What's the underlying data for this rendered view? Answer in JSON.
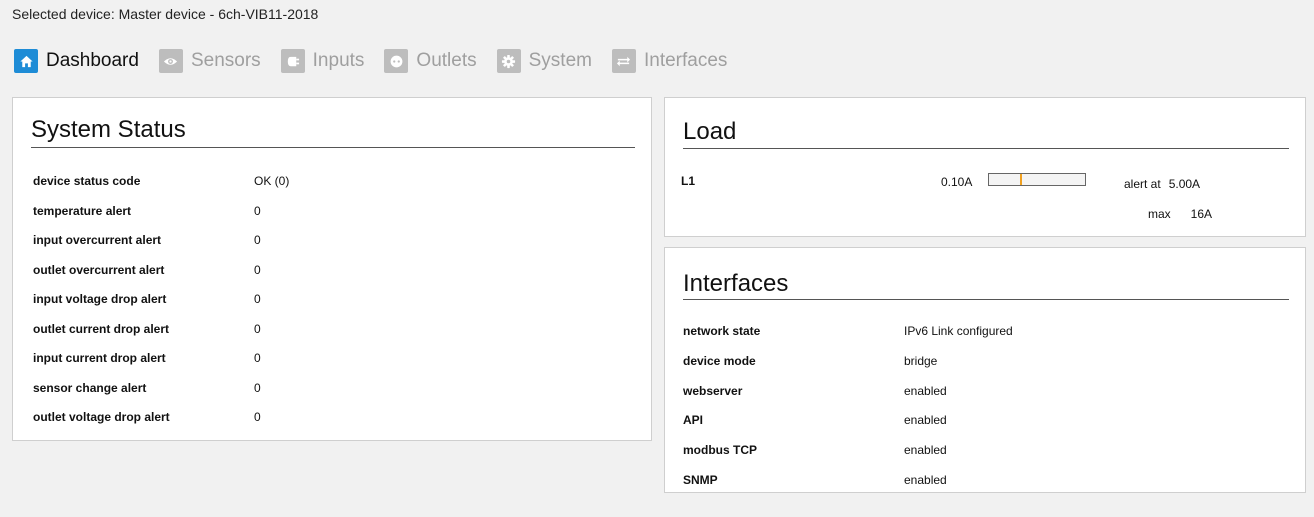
{
  "header": {
    "selected_device": "Selected device: Master device - 6ch-VIB11-2018"
  },
  "nav": {
    "items": [
      {
        "label": "Dashboard",
        "icon": "home-icon",
        "active": true
      },
      {
        "label": "Sensors",
        "icon": "eye-icon",
        "active": false
      },
      {
        "label": "Inputs",
        "icon": "plug-icon",
        "active": false
      },
      {
        "label": "Outlets",
        "icon": "outlet-icon",
        "active": false
      },
      {
        "label": "System",
        "icon": "gear-icon",
        "active": false
      },
      {
        "label": "Interfaces",
        "icon": "arrows-icon",
        "active": false
      }
    ]
  },
  "system_status": {
    "title": "System Status",
    "rows": [
      {
        "label": "device status code",
        "value": "OK (0)"
      },
      {
        "label": "temperature alert",
        "value": "0"
      },
      {
        "label": "input overcurrent alert",
        "value": "0"
      },
      {
        "label": "outlet overcurrent alert",
        "value": "0"
      },
      {
        "label": "input voltage drop alert",
        "value": "0"
      },
      {
        "label": "outlet current drop alert",
        "value": "0"
      },
      {
        "label": "input current drop alert",
        "value": "0"
      },
      {
        "label": "sensor change alert",
        "value": "0"
      },
      {
        "label": "outlet voltage drop alert",
        "value": "0"
      }
    ]
  },
  "load": {
    "title": "Load",
    "line": "L1",
    "current": "0.10A",
    "alert_label": "alert at",
    "alert_value": "5.00A",
    "max_label": "max",
    "max_value": "16A",
    "bar_fill_fraction": 0.32,
    "marker_color": "#f0a020"
  },
  "interfaces": {
    "title": "Interfaces",
    "rows": [
      {
        "label": "network state",
        "value": "IPv6 Link configured"
      },
      {
        "label": "device mode",
        "value": "bridge"
      },
      {
        "label": "webserver",
        "value": "enabled"
      },
      {
        "label": "API",
        "value": "enabled"
      },
      {
        "label": "modbus TCP",
        "value": "enabled"
      },
      {
        "label": "SNMP",
        "value": "enabled"
      }
    ]
  },
  "colors": {
    "accent": "#1e8cd6",
    "inactive_icon": "#bdbdbd",
    "inactive_text": "#9f9f9f",
    "background": "#f1f1f1"
  }
}
